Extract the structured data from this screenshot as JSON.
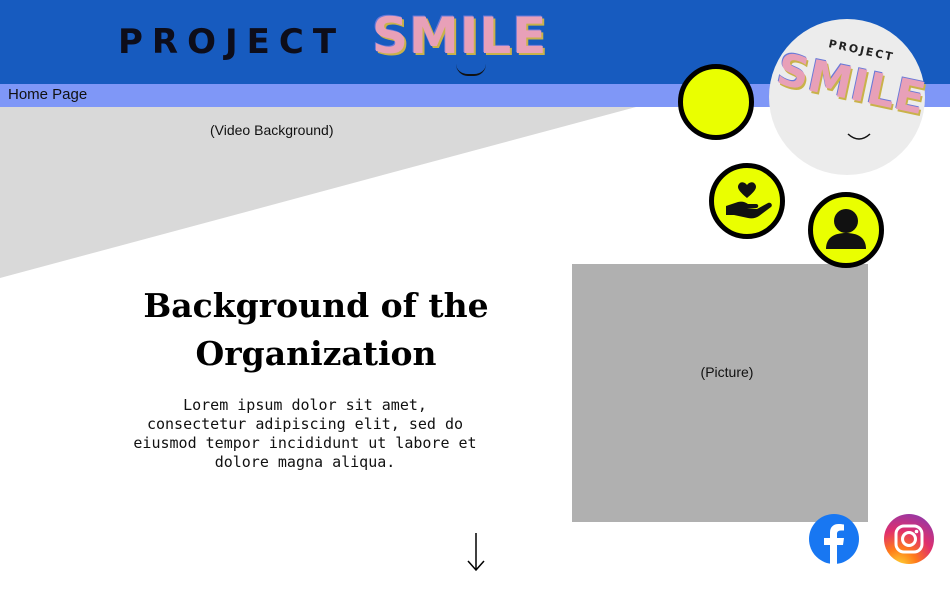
{
  "header": {
    "brand_text": "PROJECT",
    "brand_logo_text": "SMILE",
    "background": "#175bbf"
  },
  "nav": {
    "home_label": "Home Page",
    "background": "#7f97f7"
  },
  "hero": {
    "video_label": "(Video Background)"
  },
  "main": {
    "heading": "Background of the Organization",
    "body": "Lorem ipsum dolor sit amet, consectetur adipiscing elit, sed do eiusmod tempor incididunt ut labore et dolore magna aliqua.",
    "picture_label": "(Picture)"
  },
  "floating_menu": {
    "logo_text_small": "PROJECT",
    "logo_text_large": "SMILE",
    "accent": "#eaff00",
    "icons": [
      "menu-dot-icon",
      "helping-hand-heart-icon",
      "user-profile-icon"
    ]
  },
  "social": {
    "icons": [
      "facebook-icon",
      "instagram-icon"
    ]
  },
  "scroll": {
    "icon": "down-arrow-icon"
  }
}
